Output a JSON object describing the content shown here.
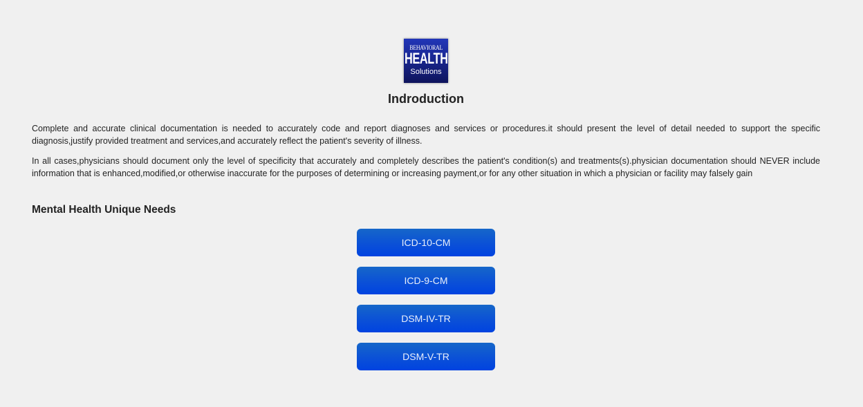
{
  "logo": {
    "line1": "BEHAVIORAL",
    "line2": "HEALTH",
    "line3": "Solutions"
  },
  "title": "Indroduction",
  "paragraphs": [
    "Complete and accurate clinical documentation is needed to accurately code and report diagnoses and services or procedures.it should present the level of detail needed to support the specific diagnosis,justify provided treatment and services,and accurately reflect the patient's severity of illness.",
    "In all cases,physicians should document only the level of specificity that accurately and completely describes the patient's condition(s) and treatments(s).physician documentation should NEVER include information that is enhanced,modified,or otherwise inaccurate for the purposes of determining or increasing payment,or for any other situation in which a physician or facility may falsely gain"
  ],
  "section_title": "Mental Health Unique Needs",
  "buttons": [
    {
      "label": "ICD-10-CM"
    },
    {
      "label": "ICD-9-CM"
    },
    {
      "label": "DSM-IV-TR"
    },
    {
      "label": "DSM-V-TR"
    }
  ],
  "colors": {
    "background": "#f0f0f0",
    "button": "#0a4fd8",
    "logo": "#1b2a9a"
  }
}
